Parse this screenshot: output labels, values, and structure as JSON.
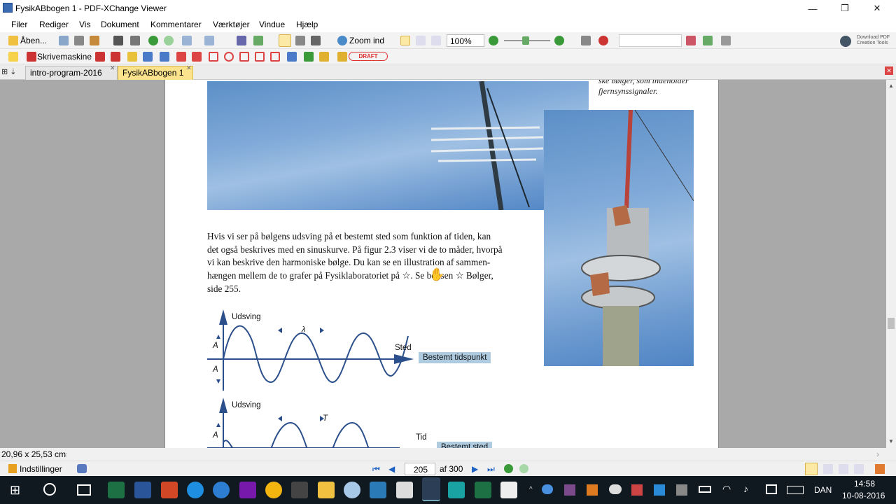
{
  "window": {
    "title": "FysikABbogen 1 - PDF-XChange Viewer"
  },
  "menu": [
    "Filer",
    "Rediger",
    "Vis",
    "Dokument",
    "Kommentarer",
    "Værktøjer",
    "Vindue",
    "Hjælp"
  ],
  "toolbar1": {
    "open_label": "Åben...",
    "zoom_tool_label": "Zoom ind",
    "zoom_value": "100%",
    "download_label_1": "Download PDF",
    "download_label_2": "Creation Tools"
  },
  "toolbar2": {
    "typewriter_label": "Skrivemaskine",
    "stamp_label": "DRAFT"
  },
  "tabs": [
    {
      "label": "intro-program-2016",
      "active": false
    },
    {
      "label": "FysikABbogen 1",
      "active": true
    }
  ],
  "page": {
    "caption_lines": [
      "ske bølger, som indeholder",
      "fjernsynssignaler."
    ],
    "paragraph_lines": [
      "Hvis vi ser på bølgens udsving på et bestemt sted som funktion af tiden, kan",
      "det også beskrives med en sinuskurve. På figur 2.3 viser vi de to måder, hvorpå",
      "vi kan beskrive den harmoniske bølge. Du kan se en illustration af sammen-",
      "hængen mellem de to grafer på Fysiklaboratoriet på ☆. Se boksen ☆ Bølger,",
      "side 255."
    ],
    "figure1": {
      "y_label": "Udsving",
      "x_label": "Sted",
      "amp_label": "A",
      "wavelength_label": "λ",
      "tag": "Bestemt tidspunkt"
    },
    "figure2": {
      "y_label": "Udsving",
      "x_label": "Tid",
      "amp_label": "A",
      "period_label": "T",
      "tag": "Bestemt sted"
    }
  },
  "status": {
    "page_size": "20,96 x 25,53 cm"
  },
  "nav": {
    "settings_label": "Indstillinger",
    "current_page": "205",
    "page_total": "af 300"
  },
  "taskbar": {
    "language": "DAN",
    "time": "14:58",
    "date": "10-08-2016"
  },
  "colors": {
    "accent_tab": "#fbe38d",
    "figure_line": "#2b4f8a",
    "tag_bg": "#aecbe0",
    "page_bg": "#a9a9a9"
  }
}
